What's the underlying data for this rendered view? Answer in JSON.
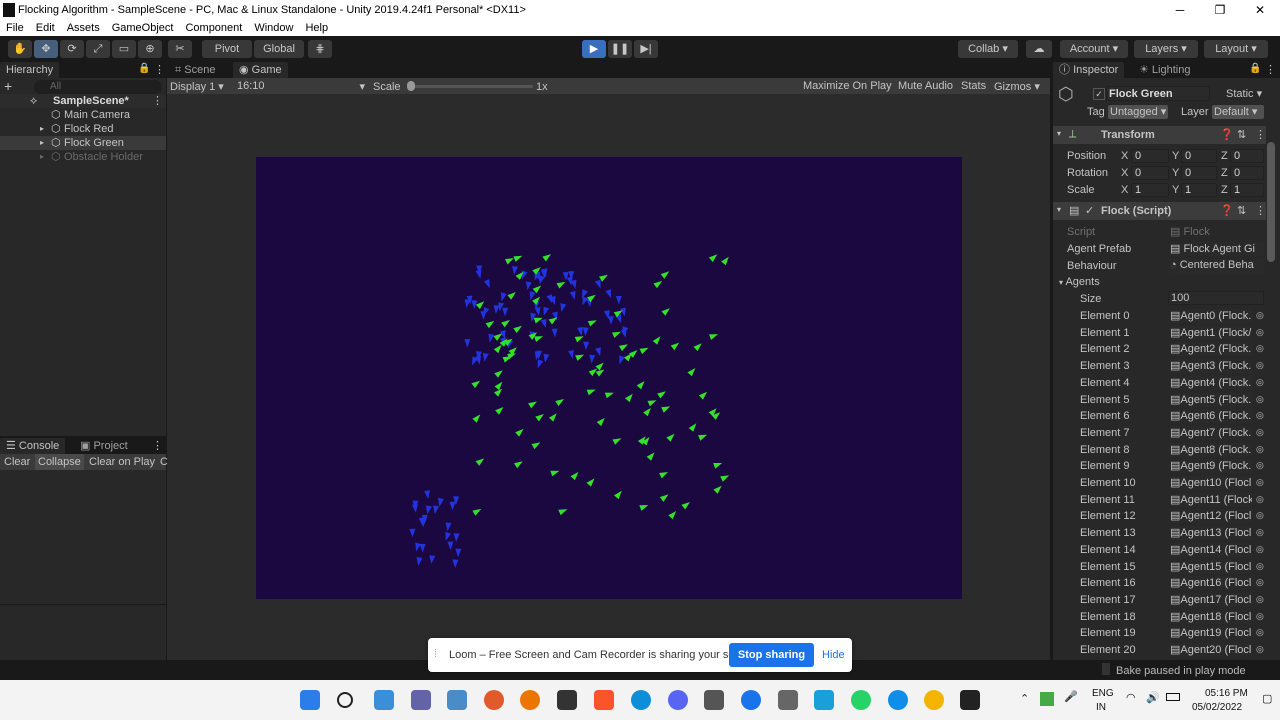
{
  "window": {
    "title": "Flocking Algorithm - SampleScene - PC, Mac & Linux Standalone - Unity 2019.4.24f1 Personal* <DX11>",
    "minimize": "─",
    "maximize": "❐",
    "close": "✕"
  },
  "menu": [
    "File",
    "Edit",
    "Assets",
    "GameObject",
    "Component",
    "Window",
    "Help"
  ],
  "toolbar": {
    "pivot": "Pivot",
    "global": "Global",
    "collab": "Collab",
    "account": "Account",
    "layers": "Layers",
    "layout": "Layout"
  },
  "hierarchy": {
    "tab": "Hierarchy",
    "search_placeholder": "All",
    "items": [
      "SampleScene*",
      "Main Camera",
      "Flock Red",
      "Flock Green",
      "Obstacle Holder"
    ]
  },
  "console": {
    "tabs": [
      "Console",
      "Project"
    ],
    "buttons": [
      "Clear",
      "Collapse",
      "Clear on Play",
      "C"
    ]
  },
  "game_view": {
    "tabs": [
      "Scene",
      "Game"
    ],
    "display": "Display 1",
    "aspect": "16:10",
    "scale_label": "Scale",
    "scale_value": "1x",
    "options": [
      "Maximize On Play",
      "Mute Audio",
      "Stats",
      "Gizmos"
    ],
    "background_color": "#1c0841",
    "blue_agent_color": "#2233e0",
    "green_agent_color": "#33e02a"
  },
  "inspector": {
    "tabs": [
      "Inspector",
      "Lighting"
    ],
    "object_name": "Flock Green",
    "static_label": "Static",
    "tag_label": "Tag",
    "tag_value": "Untagged",
    "layer_label": "Layer",
    "layer_value": "Default",
    "transform": {
      "title": "Transform",
      "rows": [
        {
          "label": "Position",
          "x": "0",
          "y": "0",
          "z": "0"
        },
        {
          "label": "Rotation",
          "x": "0",
          "y": "0",
          "z": "0"
        },
        {
          "label": "Scale",
          "x": "1",
          "y": "1",
          "z": "1"
        }
      ]
    },
    "flock": {
      "title": "Flock (Script)",
      "script_label": "Script",
      "script_value": "Flock",
      "agent_prefab_label": "Agent Prefab",
      "agent_prefab_value": "Flock Agent Gi",
      "behaviour_label": "Behaviour",
      "behaviour_value": "Centered Beha",
      "agents_label": "Agents",
      "size_label": "Size",
      "size_value": "100",
      "elements": [
        {
          "label": "Element 0",
          "value": "Agent0 (Flock."
        },
        {
          "label": "Element 1",
          "value": "Agent1 (Flock/"
        },
        {
          "label": "Element 2",
          "value": "Agent2 (Flock."
        },
        {
          "label": "Element 3",
          "value": "Agent3 (Flock."
        },
        {
          "label": "Element 4",
          "value": "Agent4 (Flock."
        },
        {
          "label": "Element 5",
          "value": "Agent5 (Flock."
        },
        {
          "label": "Element 6",
          "value": "Agent6 (Flock."
        },
        {
          "label": "Element 7",
          "value": "Agent7 (Flock."
        },
        {
          "label": "Element 8",
          "value": "Agent8 (Flock."
        },
        {
          "label": "Element 9",
          "value": "Agent9 (Flock."
        },
        {
          "label": "Element 10",
          "value": "Agent10 (Flocl"
        },
        {
          "label": "Element 11",
          "value": "Agent11 (Flock"
        },
        {
          "label": "Element 12",
          "value": "Agent12 (Flocl"
        },
        {
          "label": "Element 13",
          "value": "Agent13 (Flocl"
        },
        {
          "label": "Element 14",
          "value": "Agent14 (Flocl"
        },
        {
          "label": "Element 15",
          "value": "Agent15 (Flocl"
        },
        {
          "label": "Element 16",
          "value": "Agent16 (Flocl"
        },
        {
          "label": "Element 17",
          "value": "Agent17 (Flocl"
        },
        {
          "label": "Element 18",
          "value": "Agent18 (Flocl"
        },
        {
          "label": "Element 19",
          "value": "Agent19 (Flocl"
        },
        {
          "label": "Element 20",
          "value": "Agent20 (Flocl"
        }
      ]
    }
  },
  "status_bar": {
    "message": "Bake paused in play mode"
  },
  "loom": {
    "message": "Loom – Free Screen and Cam Recorder is sharing your screen.",
    "stop": "Stop sharing",
    "hide": "Hide"
  },
  "taskbar": {
    "lang": "ENG",
    "region": "IN",
    "time": "05:16 PM",
    "date": "05/02/2022"
  }
}
